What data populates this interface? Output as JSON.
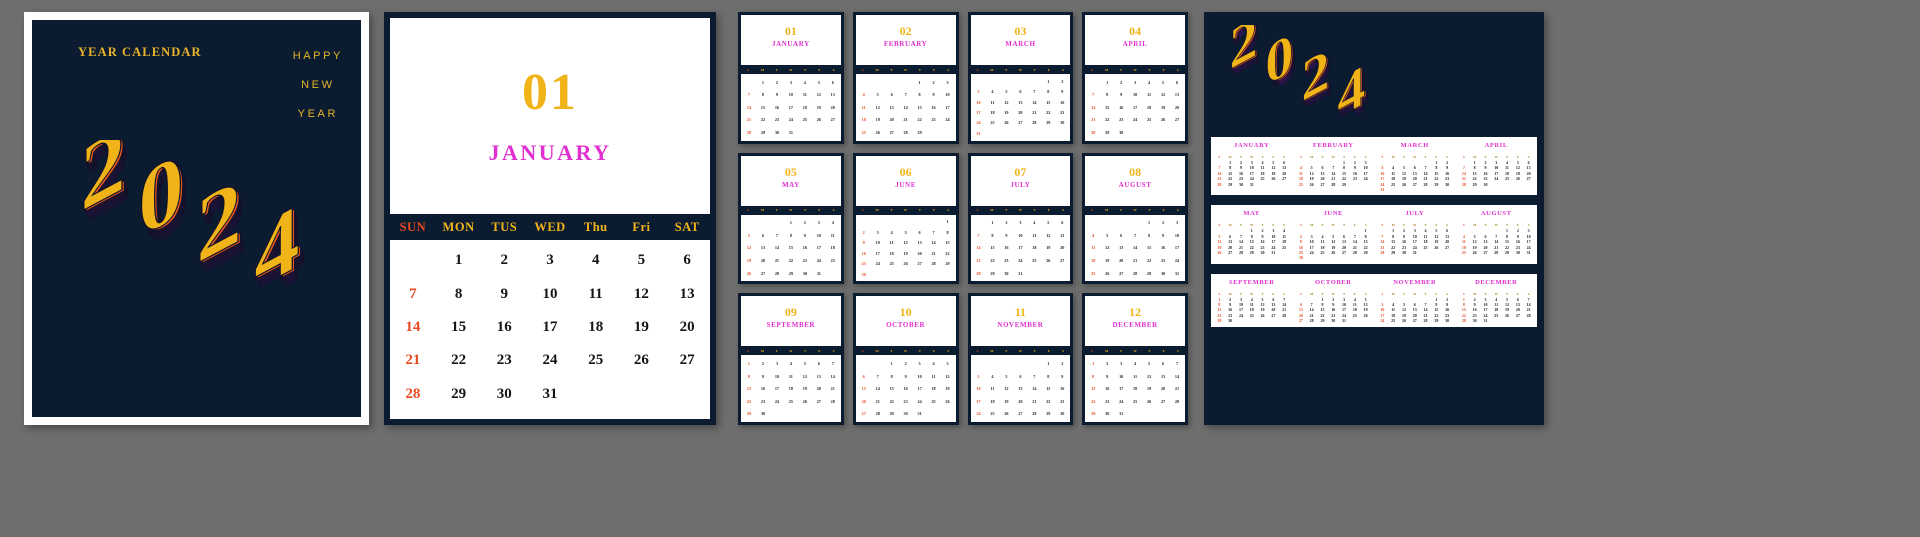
{
  "meta": {
    "background_color": "#6e6e6e",
    "dark_navy": "#0b1b30",
    "gold": "#f0b418",
    "magenta": "#e02fd0",
    "red": "#e8491f",
    "orange": "#ec5a1e",
    "purple": "#7b2fe0",
    "pink": "#f0189b",
    "year": "2024"
  },
  "cover": {
    "title": "YEAR CALENDAR",
    "greeting": [
      "HAPPY",
      "NEW",
      "YEAR"
    ],
    "logo_text": "2024"
  },
  "january_page": {
    "number": "01",
    "month": "JANUARY",
    "weekdays": [
      "SUN",
      "MON",
      "TUS",
      "WED",
      "Thu",
      "Fri",
      "SAT"
    ],
    "weeks": [
      [
        "",
        "1",
        "2",
        "3",
        "4",
        "5",
        "6"
      ],
      [
        "7",
        "8",
        "9",
        "10",
        "11",
        "12",
        "13"
      ],
      [
        "14",
        "15",
        "16",
        "17",
        "18",
        "19",
        "20"
      ],
      [
        "21",
        "22",
        "23",
        "24",
        "25",
        "26",
        "27"
      ],
      [
        "28",
        "29",
        "30",
        "31",
        "",
        "",
        ""
      ]
    ]
  },
  "month_cards": {
    "weekdays": [
      "S",
      "M",
      "T",
      "W",
      "T",
      "F",
      "S"
    ],
    "items": [
      {
        "number": "01",
        "name": "JANUARY",
        "start": 1,
        "days": 31
      },
      {
        "number": "02",
        "name": "FEBRUARY",
        "start": 4,
        "days": 29
      },
      {
        "number": "03",
        "name": "MARCH",
        "start": 5,
        "days": 31
      },
      {
        "number": "04",
        "name": "APRIL",
        "start": 1,
        "days": 30
      },
      {
        "number": "05",
        "name": "MAY",
        "start": 3,
        "days": 31
      },
      {
        "number": "06",
        "name": "JUNE",
        "start": 6,
        "days": 30
      },
      {
        "number": "07",
        "name": "JULY",
        "start": 1,
        "days": 31
      },
      {
        "number": "08",
        "name": "AUGUST",
        "start": 4,
        "days": 31
      },
      {
        "number": "09",
        "name": "SEPTEMBER",
        "start": 0,
        "days": 30
      },
      {
        "number": "10",
        "name": "OCTOBER",
        "start": 2,
        "days": 31
      },
      {
        "number": "11",
        "name": "NOVEMBER",
        "start": 5,
        "days": 30
      },
      {
        "number": "12",
        "name": "DECEMBER",
        "start": 0,
        "days": 31
      }
    ]
  },
  "year_overview": {
    "logo_text": "2024",
    "weekdays": [
      "S",
      "M",
      "T",
      "W",
      "T",
      "F",
      "S"
    ],
    "rows": [
      {
        "names": [
          "JANUARY",
          "FEBRUARY",
          "MARCH",
          "APRIL"
        ],
        "months": [
          {
            "name": "JANUARY",
            "start": 1,
            "days": 31
          },
          {
            "name": "FEBRUARY",
            "start": 4,
            "days": 29
          },
          {
            "name": "MARCH",
            "start": 5,
            "days": 31
          },
          {
            "name": "APRIL",
            "start": 1,
            "days": 30
          }
        ]
      },
      {
        "names": [
          "MAY",
          "JUNE",
          "JULY",
          "AUGUST"
        ],
        "months": [
          {
            "name": "MAY",
            "start": 3,
            "days": 31
          },
          {
            "name": "JUNE",
            "start": 6,
            "days": 30
          },
          {
            "name": "JULY",
            "start": 1,
            "days": 31
          },
          {
            "name": "AUGUST",
            "start": 4,
            "days": 31
          }
        ]
      },
      {
        "names": [
          "SEPTEMBER",
          "OCTOBER",
          "NOVEMBER",
          "DECEMBER"
        ],
        "months": [
          {
            "name": "SEPTEMBER",
            "start": 0,
            "days": 30
          },
          {
            "name": "OCTOBER",
            "start": 2,
            "days": 31
          },
          {
            "name": "NOVEMBER",
            "start": 5,
            "days": 30
          },
          {
            "name": "DECEMBER",
            "start": 0,
            "days": 31
          }
        ]
      }
    ]
  }
}
